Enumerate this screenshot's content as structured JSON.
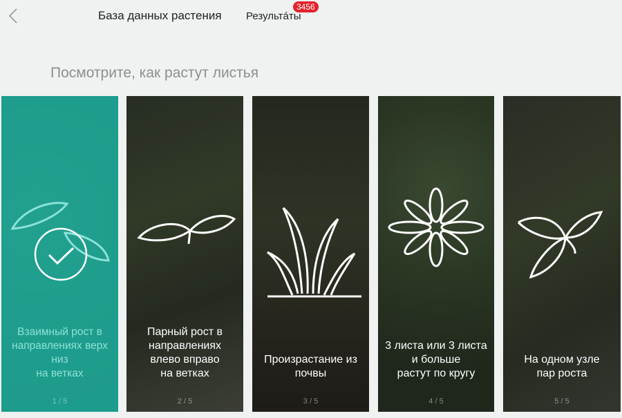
{
  "header": {
    "back_icon": "chevron-left-icon",
    "title": "База данных растения",
    "results_label": "Результáты",
    "results_count": "3456"
  },
  "heading": "Посмотрите, как растут листья",
  "cards": [
    {
      "caption": "Взаимный рост в\nнаправлениях верх\nниз\nна ветках",
      "counter": "1 / 5",
      "icon": "alternate-leaves-icon",
      "selected": true
    },
    {
      "caption": "Парный рост в\nнаправлениях\nвлево вправо\nна ветках",
      "counter": "2 / 5",
      "icon": "opposite-leaves-icon",
      "selected": false
    },
    {
      "caption": "Произрастание из\nпочвы",
      "counter": "3 / 5",
      "icon": "grass-from-soil-icon",
      "selected": false
    },
    {
      "caption": "3 листа или 3 листа\nи больше\nрастут по кругу",
      "counter": "4 / 5",
      "icon": "whorled-leaves-icon",
      "selected": false
    },
    {
      "caption": "На одном узле\nпар роста",
      "counter": "5 / 5",
      "icon": "node-growth-icon",
      "selected": false
    }
  ],
  "colors": {
    "accent": "#1ca091",
    "badge": "#e3232a"
  }
}
